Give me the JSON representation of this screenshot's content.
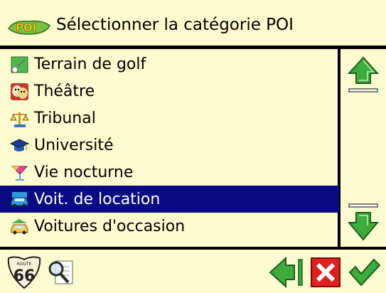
{
  "header": {
    "badge_icon": "poi-icon",
    "title": "Sélectionner la catégorie POI"
  },
  "list": {
    "items": [
      {
        "label": "Terrain de golf",
        "icon": "golf-icon"
      },
      {
        "label": "Théâtre",
        "icon": "theatre-masks-icon"
      },
      {
        "label": "Tribunal",
        "icon": "scales-icon"
      },
      {
        "label": "Université",
        "icon": "graduation-cap-icon"
      },
      {
        "label": "Vie nocturne",
        "icon": "nightlife-icon"
      },
      {
        "label": "Voit. de location",
        "icon": "rental-car-icon",
        "selected": true
      },
      {
        "label": "Voitures d'occasion",
        "icon": "used-car-icon"
      }
    ]
  },
  "scrollbar": {
    "up_icon": "arrow-up-icon",
    "down_icon": "arrow-down-icon"
  },
  "toolbar": {
    "route_icon": "route-66-icon",
    "route_text": "66",
    "route_badge_text": "ROUTE",
    "search_icon": "search-icon",
    "back_icon": "back-icon",
    "close_icon": "close-icon",
    "ok_icon": "checkmark-icon"
  },
  "colors": {
    "background": "#fdfbd0",
    "selection": "#0a0a82",
    "green": "#3aa83a",
    "red": "#e02020"
  }
}
